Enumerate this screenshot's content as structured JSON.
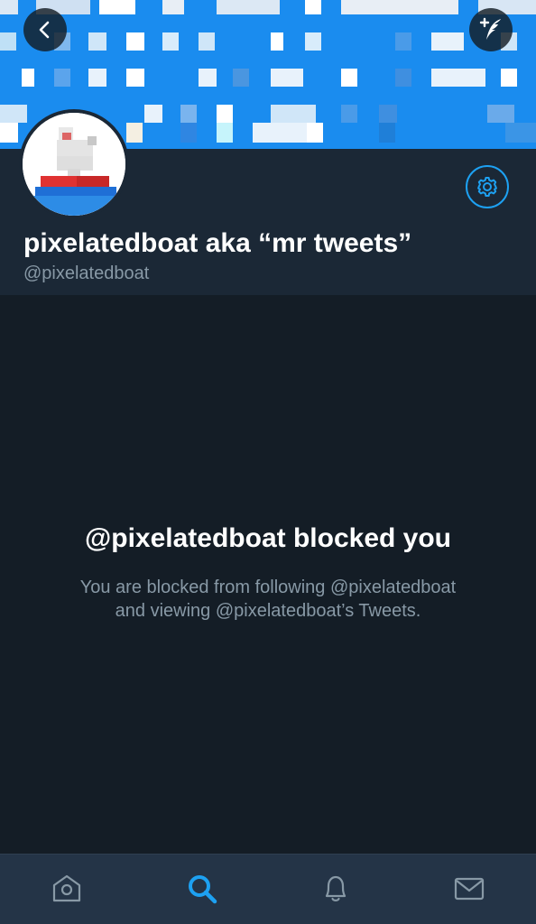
{
  "header": {
    "back_icon": "chevron-left-icon",
    "compose_icon": "compose-tweet-icon",
    "banner_color": "#1a8cef"
  },
  "profile": {
    "display_name": "pixelatedboat aka “mr tweets”",
    "handle": "@pixelatedboat",
    "settings_icon": "gear-icon"
  },
  "blocked": {
    "title": "@pixelatedboat blocked you",
    "message_line1": "You are blocked from following @pixelatedboat",
    "message_line2": "and viewing @pixelatedboat’s Tweets."
  },
  "tabbar": {
    "tabs": [
      {
        "icon": "home-icon",
        "active": false
      },
      {
        "icon": "search-icon",
        "active": true
      },
      {
        "icon": "notifications-icon",
        "active": false
      },
      {
        "icon": "messages-icon",
        "active": false
      }
    ],
    "active_color": "#1da1f2",
    "inactive_color": "#8899a6"
  },
  "colors": {
    "background": "#141d26",
    "header_bg": "#1b2836",
    "accent": "#1da1f2",
    "secondary_text": "#8899a6"
  }
}
